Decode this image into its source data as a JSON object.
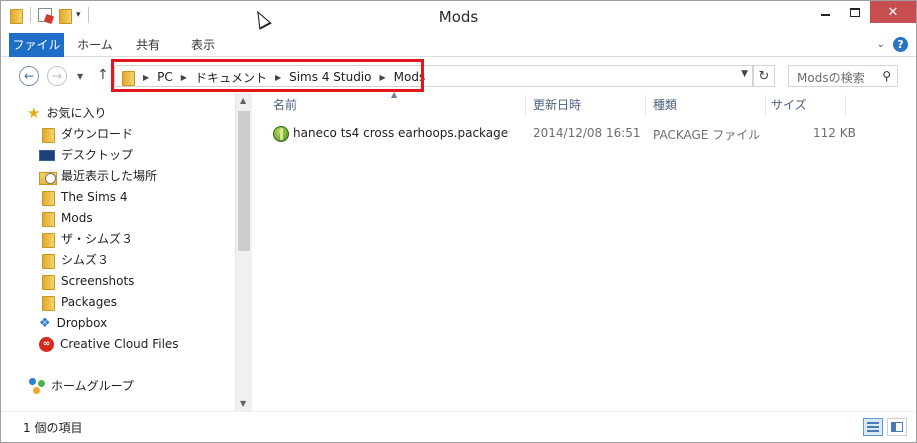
{
  "window": {
    "title": "Mods"
  },
  "ribbon": {
    "tabs": [
      "ファイル",
      "ホーム",
      "共有",
      "表示"
    ]
  },
  "address": {
    "crumbs": [
      "PC",
      "ドキュメント",
      "Sims 4 Studio",
      "Mods"
    ],
    "search_placeholder": "Modsの検索"
  },
  "navigation": {
    "favorites_label": "お気に入り",
    "items": [
      {
        "label": "ダウンロード",
        "icon": "downloads-folder-icon"
      },
      {
        "label": "デスクトップ",
        "icon": "desktop-icon"
      },
      {
        "label": "最近表示した場所",
        "icon": "recent-places-icon"
      },
      {
        "label": "The Sims 4",
        "icon": "folder-icon"
      },
      {
        "label": "Mods",
        "icon": "folder-icon"
      },
      {
        "label": "ザ・シムズ３",
        "icon": "folder-icon"
      },
      {
        "label": "シムズ３",
        "icon": "folder-icon"
      },
      {
        "label": "Screenshots",
        "icon": "folder-icon"
      },
      {
        "label": "Packages",
        "icon": "folder-icon"
      },
      {
        "label": "Dropbox",
        "icon": "dropbox-icon"
      },
      {
        "label": "Creative Cloud Files",
        "icon": "creative-cloud-icon"
      }
    ],
    "homegroup_label": "ホームグループ"
  },
  "file_list": {
    "columns": [
      "名前",
      "更新日時",
      "種類",
      "サイズ"
    ],
    "rows": [
      {
        "name": "haneco ts4 cross earhoops.package",
        "modified": "2014/12/08 16:51",
        "type": "PACKAGE ファイル",
        "size": "112 KB"
      }
    ]
  },
  "status": {
    "item_count": "1 個の項目"
  },
  "colors": {
    "file_tab": "#1e6ec8",
    "close_button": "#c74e4e",
    "highlight_box": "#e2161d",
    "column_header_text": "#4d6082"
  }
}
